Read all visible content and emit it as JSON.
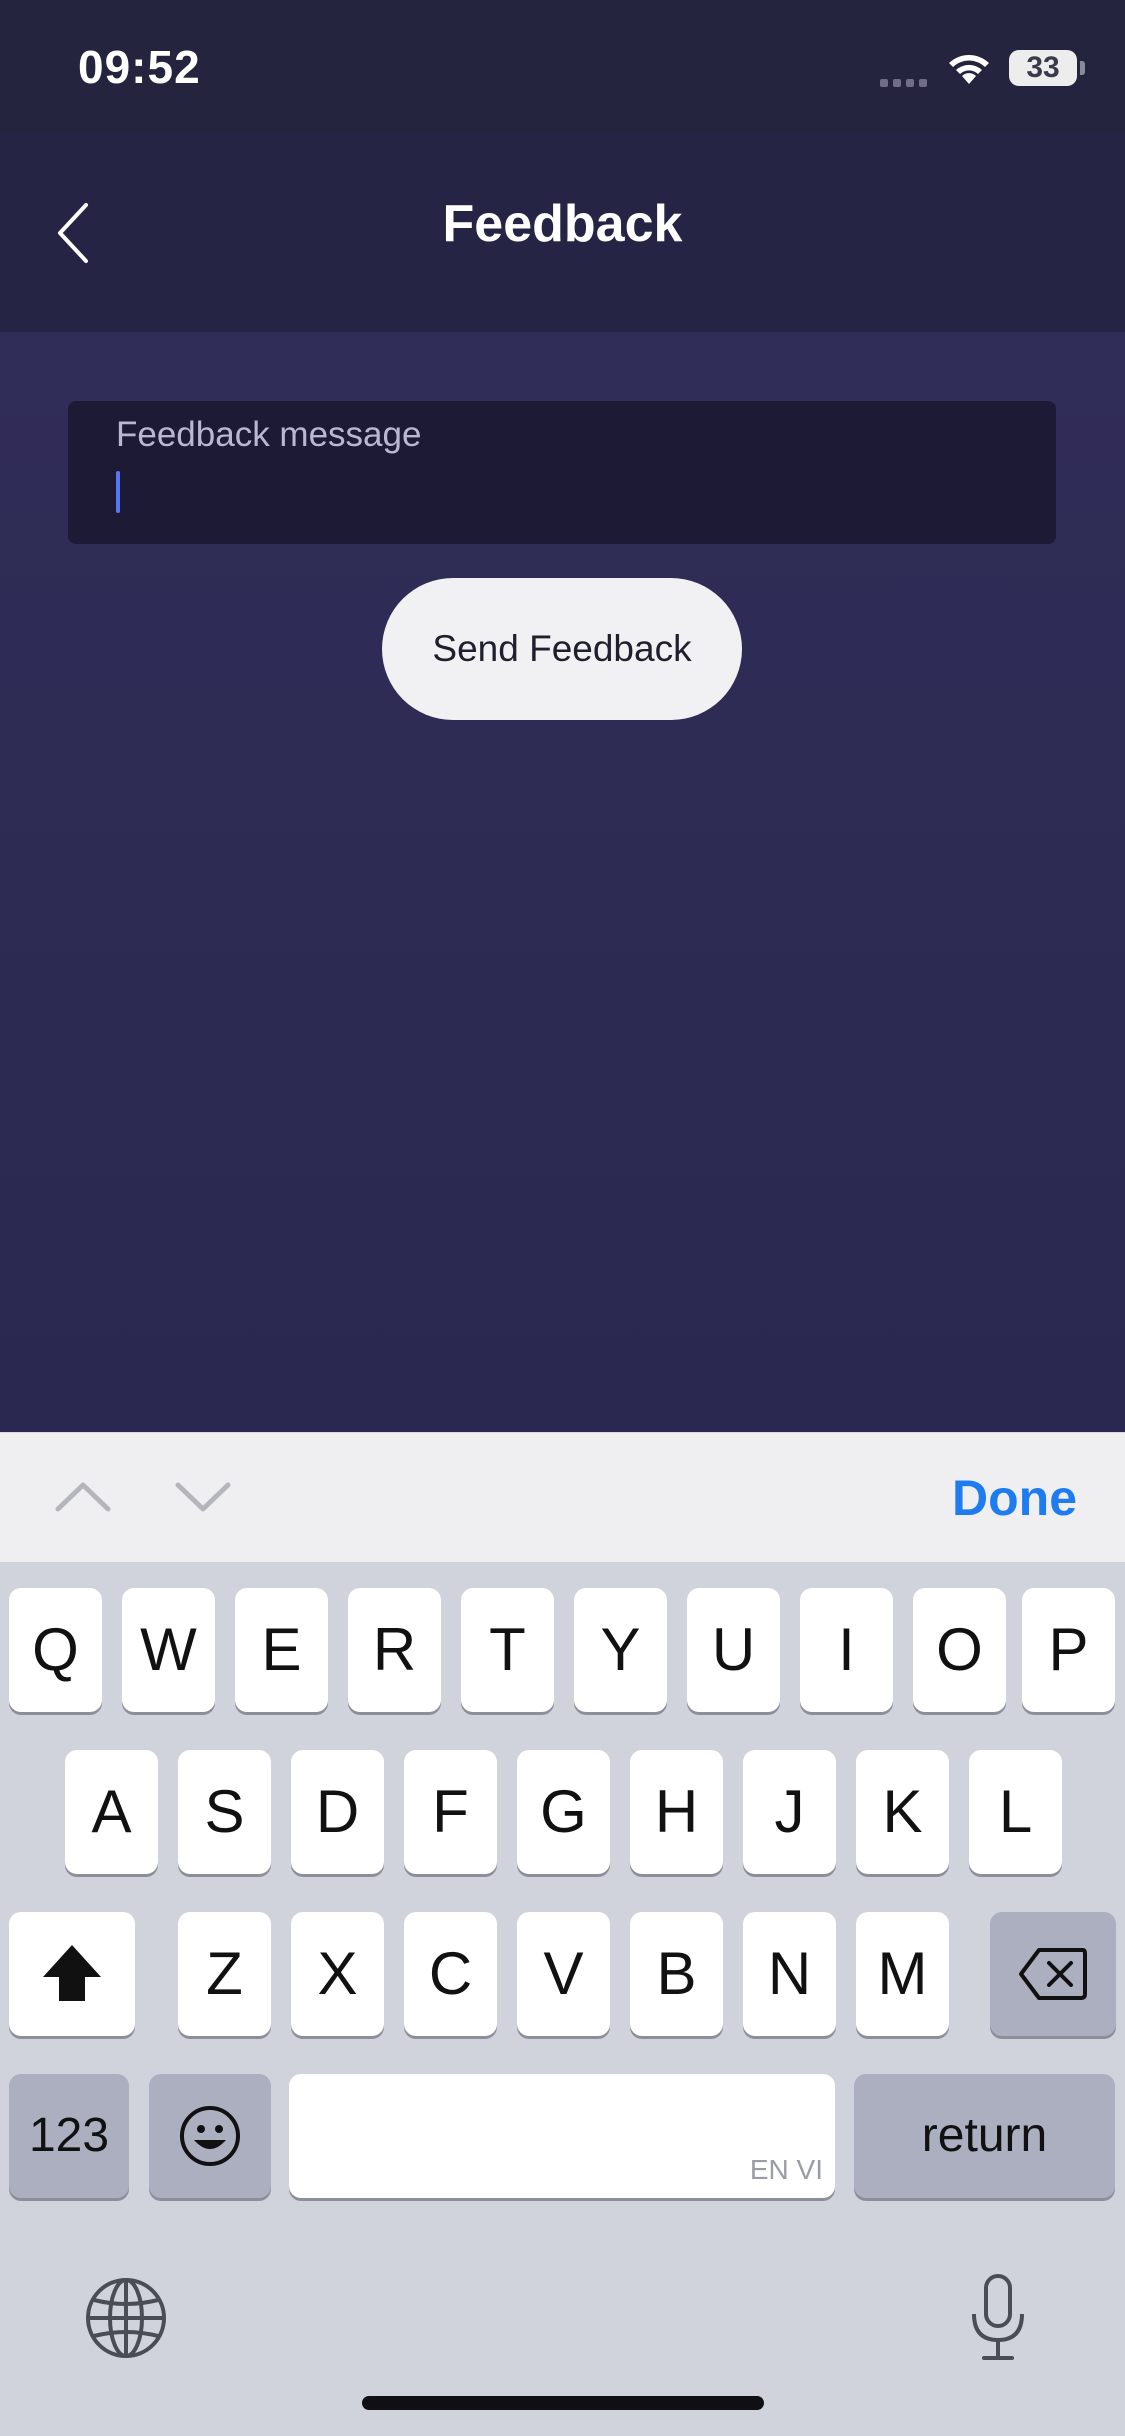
{
  "status_bar": {
    "time": "09:52",
    "battery": "33"
  },
  "header": {
    "title": "Feedback"
  },
  "form": {
    "field_label": "Feedback message",
    "value": "",
    "send_label": "Send Feedback"
  },
  "accessory": {
    "done_label": "Done"
  },
  "keyboard": {
    "row1": [
      "Q",
      "W",
      "E",
      "R",
      "T",
      "Y",
      "U",
      "I",
      "O",
      "P"
    ],
    "row2": [
      "A",
      "S",
      "D",
      "F",
      "G",
      "H",
      "J",
      "K",
      "L"
    ],
    "row3": [
      "Z",
      "X",
      "C",
      "V",
      "B",
      "N",
      "M"
    ],
    "numbers_label": "123",
    "return_label": "return",
    "space_hint": "EN VI"
  },
  "icons": {
    "back": "chevron-left-icon",
    "wifi": "wifi-icon",
    "shift": "shift-arrow-icon",
    "delete": "backspace-icon",
    "emoji": "emoji-face-icon",
    "globe": "globe-icon",
    "mic": "microphone-icon"
  },
  "colors": {
    "accent": "#1f7cf0",
    "background": "#2d2b52",
    "caret": "#5b74f4"
  }
}
